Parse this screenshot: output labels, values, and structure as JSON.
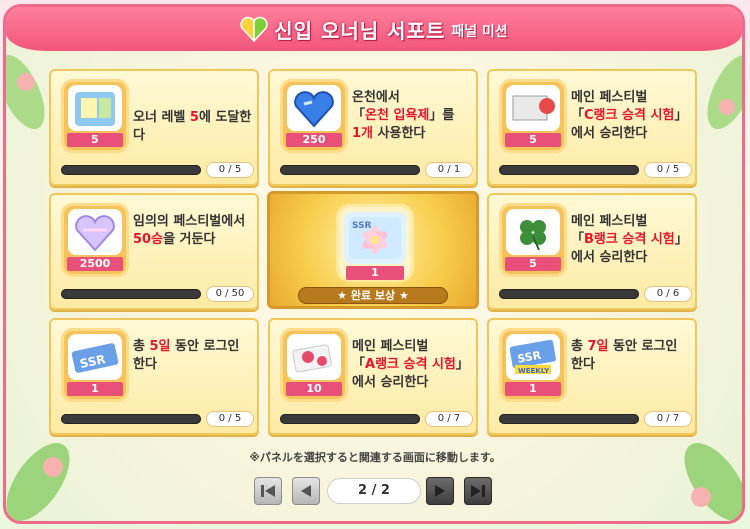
{
  "header": {
    "title": "신입 오너님 서포트",
    "subtitle": "패널 미션"
  },
  "colors": {
    "frame": "#f06a8a",
    "accent_red": "#e3162e",
    "bar_fill": "#f49a2a",
    "panel_bg": "#fdeaa3"
  },
  "missions": [
    {
      "icon": "photo-card-icon",
      "qty": "5",
      "line1": "오너 레벨 ",
      "hl1": "5",
      "line1b": "에 도달한다",
      "line2": "",
      "hl2": "",
      "line2b": "",
      "line3": "",
      "progress": "0 / 5",
      "fill": 0
    },
    {
      "icon": "blue-heart-gem-icon",
      "qty": "250",
      "line1": "온천에서",
      "hl1": "",
      "line1b": "",
      "line2": "「",
      "hl2": "온천 입욕제",
      "line2b": "」를",
      "line3a": "",
      "hl3": "1개",
      "line3b": " 사용한다",
      "progress": "0 / 1",
      "fill": 0
    },
    {
      "icon": "ticket-icon",
      "qty": "5",
      "line1": "메인 페스티벌",
      "hl1": "",
      "line1b": "",
      "line2": "「",
      "hl2": "C랭크 승격 시험",
      "line2b": "」",
      "line3a": "에서 승리한다",
      "hl3": "",
      "line3b": "",
      "progress": "0 / 5",
      "fill": 0
    },
    {
      "icon": "rainbow-heart-gem-icon",
      "qty": "2500",
      "line1": "임의의 페스티벌에서",
      "hl1": "",
      "line1b": "",
      "line2": "",
      "hl2": "50승",
      "line2b": "을 거둔다",
      "line3a": "",
      "hl3": "",
      "line3b": "",
      "progress": "0 / 50",
      "fill": 0
    },
    {
      "icon": "clover-icon",
      "qty": "5",
      "line1": "메인 페스티벌",
      "hl1": "",
      "line1b": "",
      "line2": "「",
      "hl2": "B랭크 승격 시험",
      "line2b": "」",
      "line3a": "에서 승리한다",
      "hl3": "",
      "line3b": "",
      "progress": "0 / 6",
      "fill": 0
    },
    {
      "icon": "ssr-ticket-icon",
      "qty": "1",
      "line1": "총 ",
      "hl1": "5일",
      "line1b": " 동안 로그인",
      "line2": "한다",
      "hl2": "",
      "line2b": "",
      "line3a": "",
      "hl3": "",
      "line3b": "",
      "progress": "0 / 5",
      "fill": 0
    },
    {
      "icon": "red-ticket-icon",
      "qty": "10",
      "line1": "메인 페스티벌",
      "hl1": "",
      "line1b": "",
      "line2": "「",
      "hl2": "A랭크 승격 시험",
      "line2b": "」",
      "line3a": "에서 승리한다",
      "hl3": "",
      "line3b": "",
      "progress": "0 / 7",
      "fill": 0
    },
    {
      "icon": "ssr-weekly-ticket-icon",
      "qty": "1",
      "line1": "총 ",
      "hl1": "7일",
      "line1b": " 동안 로그인",
      "line2": "한다",
      "hl2": "",
      "line2b": "",
      "line3a": "",
      "hl3": "",
      "line3b": "",
      "progress": "0 / 7",
      "fill": 0
    }
  ],
  "center": {
    "icon": "ssr-flower-icon",
    "qty": "1",
    "label": "★ 완료 보상 ★"
  },
  "footer": {
    "note": "※パネルを選択すると関連する画面に移動します。",
    "page": "2 / 2"
  }
}
